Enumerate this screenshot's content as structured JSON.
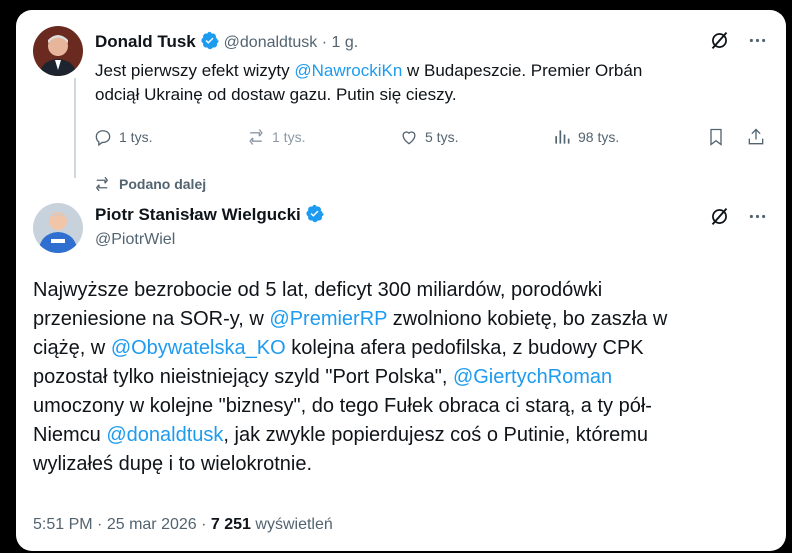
{
  "tweet1": {
    "name": "Donald Tusk",
    "handle": "@donaldtusk",
    "sep": "·",
    "time": "1 g.",
    "text_a": "Jest pierwszy efekt wizyty ",
    "mention1": "@NawrockiKn",
    "text_b": " w Budapeszcie. Premier Orbán",
    "text_c": "odciął Ukrainę od dostaw gazu. Putin się cieszy.",
    "replies": "1 tys.",
    "reposts": "1 tys.",
    "likes": "5 tys.",
    "views": "98 tys."
  },
  "repost_label": "Podano dalej",
  "tweet2": {
    "name": "Piotr Stanisław Wielgucki",
    "handle": "@PiotrWiel",
    "l1": "Najwyższe bezrobocie od 5 lat, deficyt 300 miliardów, porodówki",
    "l2a": "przeniesione na SOR-y, w ",
    "m_premier": "@PremierRP",
    "l2b": " zwolniono kobietę, bo zaszła w",
    "l3a": "ciążę, w ",
    "m_ko": "@Obywatelska_KO",
    "l3b": " kolejna afera pedofilska, z budowy CPK",
    "l4a": "pozostał tylko nieistniejący szyld \"Port Polska\", ",
    "m_giertych": "@GiertychRoman",
    "l5": "umoczony w kolejne \"biznesy\", do tego Fułek obraca ci starą, a ty pół-",
    "l6a": "Niemcu ",
    "m_tusk": "@donaldtusk",
    "l6b": ", jak zwykle popierdujesz coś o Putinie, któremu",
    "l7": "wylizałeś dupę i to wielokrotnie.",
    "time": "5:51 PM",
    "sep1": "·",
    "date": "25 mar 2026",
    "sep2": "·",
    "views_count": "7 251",
    "views_label": "wyświetleń"
  },
  "colors": {
    "accent": "#1d9bf0",
    "muted": "#536471",
    "text": "#0f1419"
  },
  "icons": [
    "verified-badge-icon",
    "grok-icon",
    "more-icon",
    "reply-icon",
    "repost-icon",
    "like-icon",
    "views-icon",
    "bookmark-icon",
    "share-icon"
  ]
}
